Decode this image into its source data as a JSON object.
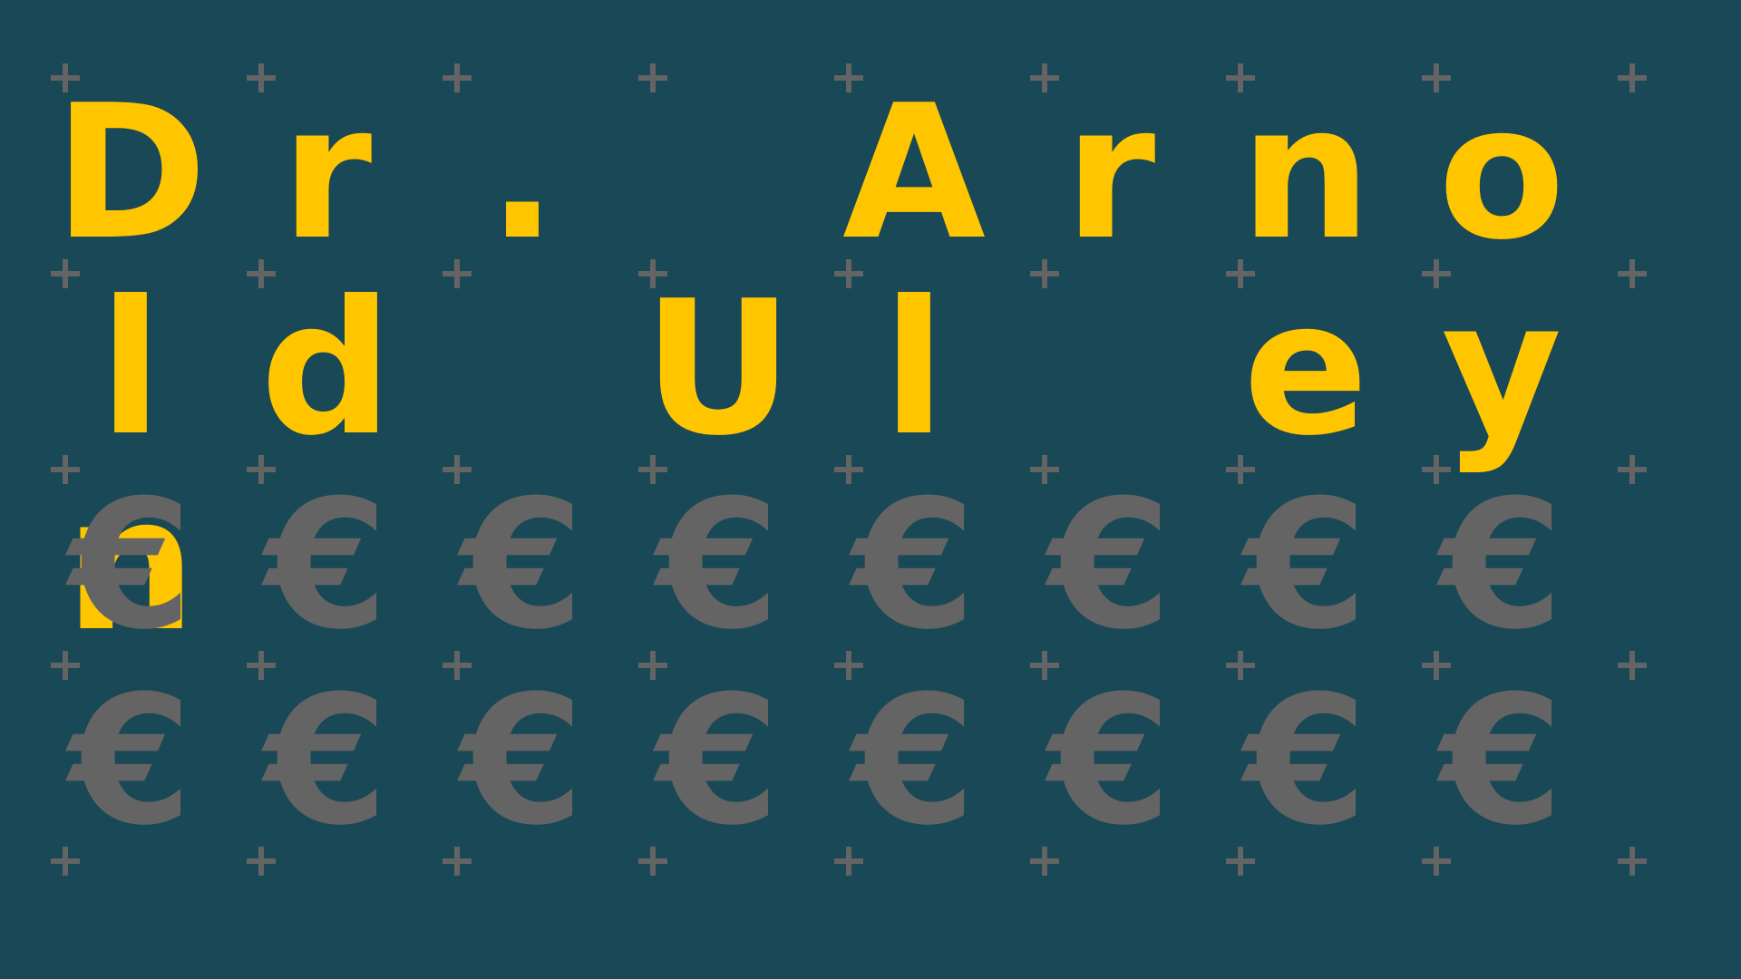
{
  "name_letters": [
    "D",
    "r",
    ".",
    "",
    "A",
    "r",
    "n",
    "o",
    "l",
    "d",
    "",
    "U",
    "l",
    "",
    "e",
    "y",
    "n"
  ],
  "euro_symbol": "€",
  "euro_count": 16,
  "colors": {
    "background": "#194856",
    "name_text": "#FFC600",
    "euro_symbol": "#646464",
    "plus_marker": "#646464"
  }
}
